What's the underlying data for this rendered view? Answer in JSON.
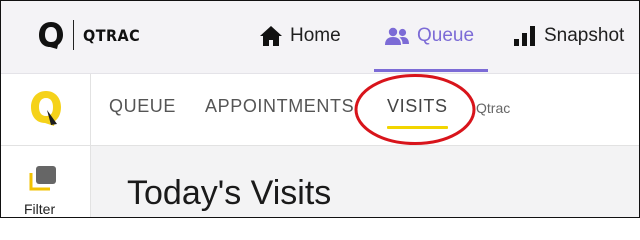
{
  "brand": {
    "name": "QTRAC",
    "logo_icon": "qtrac-q-logo-icon"
  },
  "top_nav": {
    "items": [
      {
        "label": "Home",
        "icon": "home-icon"
      },
      {
        "label": "Queue",
        "icon": "people-icon",
        "active": true
      },
      {
        "label": "Snapshot",
        "icon": "bar-chart-icon"
      }
    ],
    "accent_color": "#7c6bd6"
  },
  "sub_nav": {
    "logo_icon": "qtrac-yellow-q-icon",
    "tabs": [
      {
        "label": "QUEUE"
      },
      {
        "label": "APPOINTMENTS"
      },
      {
        "label": "VISITS",
        "active": true
      },
      {
        "label": "Qtrac"
      }
    ],
    "active_underline_color": "#f2d500",
    "annotation_color": "#d8141b"
  },
  "sidebar": {
    "filter_label": "Filter",
    "filter_icon": "filter-icon"
  },
  "main": {
    "title": "Today's Visits"
  }
}
